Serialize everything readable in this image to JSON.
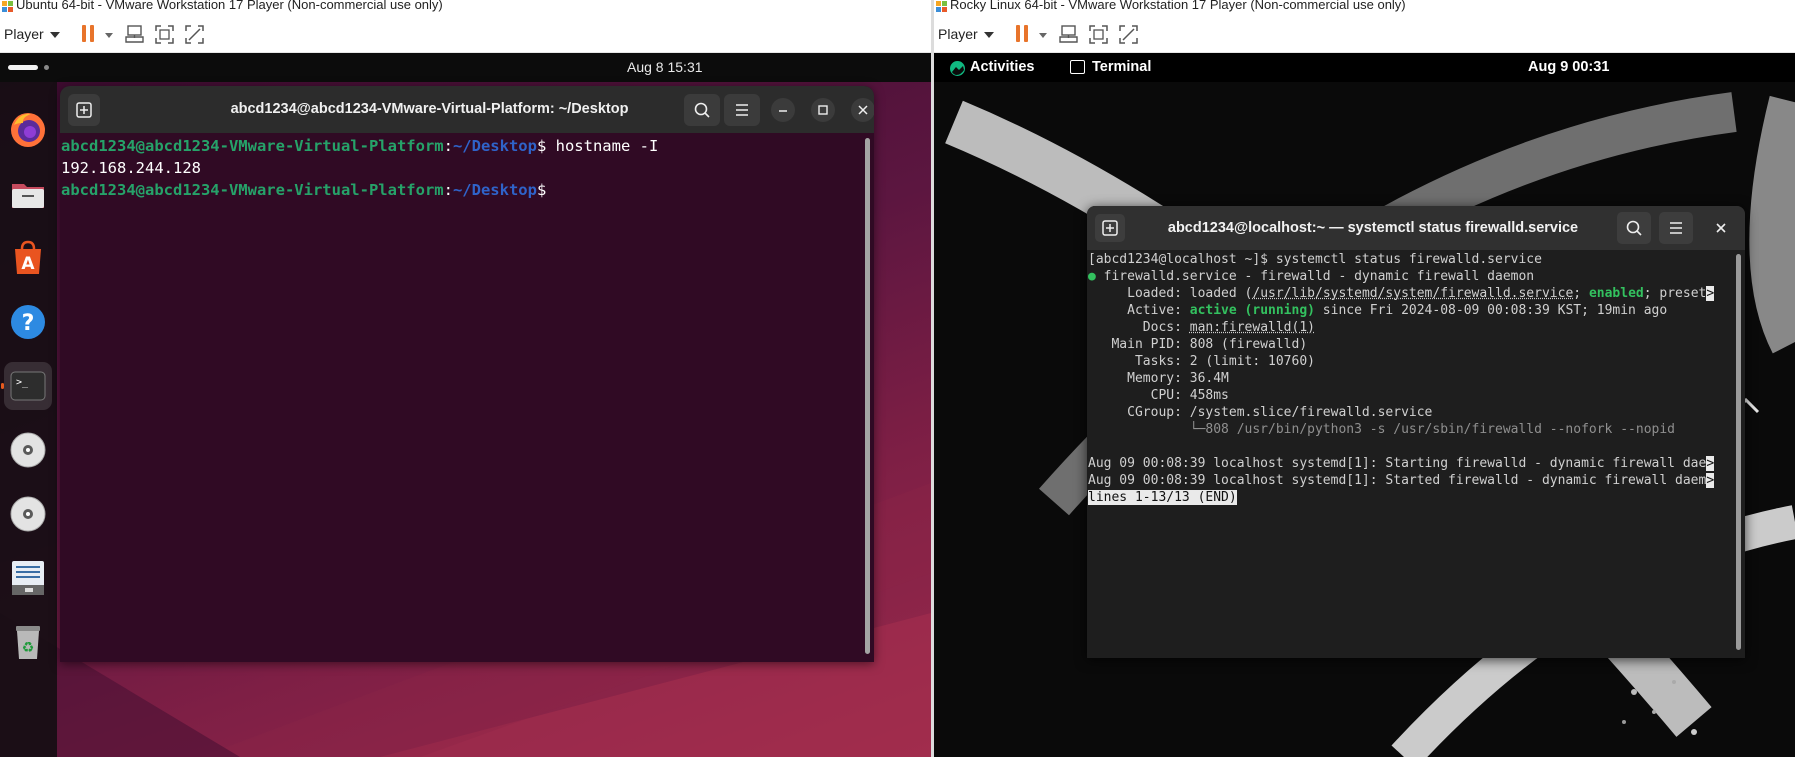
{
  "left_vm": {
    "window_title": "Ubuntu 64-bit - VMware Workstation 17 Player (Non-commercial use only)",
    "player_menu": "Player",
    "os": {
      "clock": "Aug 8  15:31",
      "dock": [
        "firefox-icon",
        "files-icon",
        "app-center-icon",
        "help-icon",
        "terminal-icon",
        "dvd-icon",
        "dvd-icon",
        "text-editor-icon",
        "trash-icon"
      ],
      "terminal": {
        "title": "abcd1234@abcd1234-VMware-Virtual-Platform: ~/Desktop",
        "prompt_user": "abcd1234@abcd1234-VMware-Virtual-Platform",
        "prompt_sep": ":",
        "prompt_path": "~/Desktop",
        "prompt_end": "$",
        "command": " hostname -I",
        "output": "192.168.244.128"
      }
    }
  },
  "right_vm": {
    "window_title": "Rocky Linux 64-bit - VMware Workstation 17 Player (Non-commercial use only)",
    "player_menu": "Player",
    "os": {
      "activities": "Activities",
      "app_name": "Terminal",
      "clock": "Aug 9  00:31",
      "terminal": {
        "title": "abcd1234@localhost:~ — systemctl status firewalld.service",
        "lines": {
          "prompt": "[abcd1234@localhost ~]$ systemctl status firewalld.service",
          "unit_dot": "●",
          "unit": " firewalld.service - firewalld - dynamic firewall daemon",
          "loaded_a": "     Loaded: loaded (",
          "loaded_path": "/usr/lib/systemd/system/firewalld.service",
          "loaded_b": "; ",
          "loaded_enabled": "enabled",
          "loaded_c": "; preset",
          "active_a": "     Active: ",
          "active_state": "active (running)",
          "active_b": " since Fri 2024-08-09 00:08:39 KST; 19min ago",
          "docs_a": "       Docs: ",
          "docs_link": "man:firewalld(1)",
          "pid": "   Main PID: 808 (firewalld)",
          "tasks": "      Tasks: 2 (limit: 10760)",
          "memory": "     Memory: 36.4M",
          "cpu": "        CPU: 458ms",
          "cgroup": "     CGroup: /system.slice/firewalld.service",
          "cgroup_child": "             └─808 /usr/bin/python3 -s /usr/sbin/firewalld --nofork --nopid",
          "log1": "Aug 09 00:08:39 localhost systemd[1]: Starting firewalld - dynamic firewall dae",
          "log2": "Aug 09 00:08:39 localhost systemd[1]: Started firewalld - dynamic firewall daem",
          "trunc_marker": ">",
          "pager": "lines 1-13/13 (END)"
        }
      }
    }
  },
  "colors": {
    "vm_pause": "#e8742b",
    "ubuntu_terminal_bg": "#300a24",
    "ubuntu_prompt_user": "#26a269",
    "ubuntu_prompt_path": "#2f63c9",
    "rocky_terminal_bg": "#1e1e1e",
    "status_green": "#33c15f"
  }
}
